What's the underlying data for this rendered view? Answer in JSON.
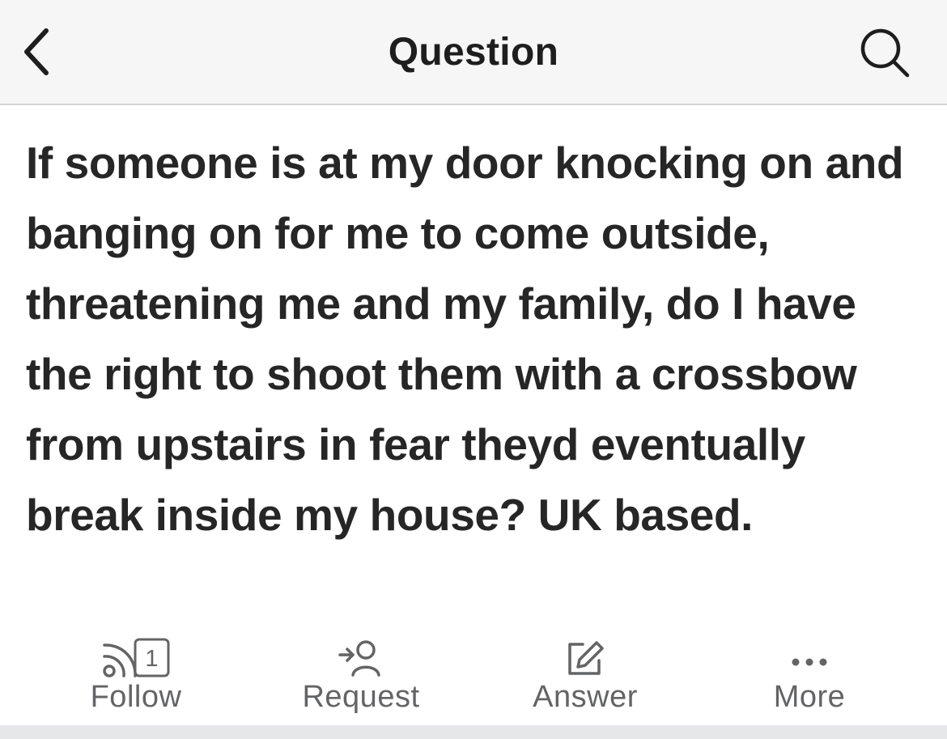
{
  "header": {
    "title": "Question"
  },
  "question": {
    "text": "If someone is at my door knocking on and banging on for me to come outside, threatening me and my family, do I have the right to shoot them with a crossbow from upstairs in fear theyd eventually break inside my house? UK based."
  },
  "actions": {
    "follow": {
      "label": "Follow",
      "count": "1",
      "icon": "follow-feed-icon"
    },
    "request": {
      "label": "Request",
      "icon": "request-person-icon"
    },
    "answer": {
      "label": "Answer",
      "icon": "pencil-edit-icon"
    },
    "more": {
      "label": "More",
      "icon": "more-dots-icon"
    }
  },
  "colors": {
    "header_bg": "#f6f6f6",
    "text": "#262626",
    "muted": "#636466"
  }
}
